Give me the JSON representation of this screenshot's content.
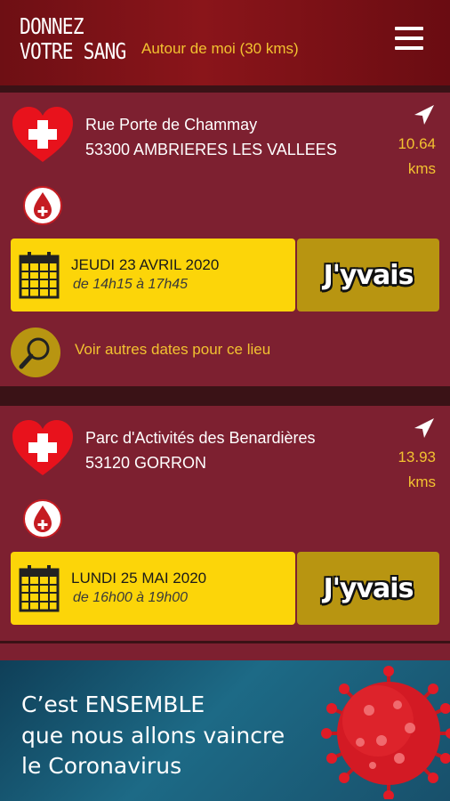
{
  "header": {
    "logo_line1": "DONNEZ",
    "logo_line2": "VOTRE SANG",
    "subtitle": "Autour de moi (30 kms)"
  },
  "collectes": [
    {
      "address_line1": "Rue Porte de Chammay",
      "address_line2": "53300 AMBRIERES LES VALLEES",
      "distance": "10.64",
      "distance_unit": "kms",
      "date": "JEUDI 23 AVRIL 2020",
      "hours": "de 14h15 à 17h45",
      "button_label": "J'yvais",
      "other_dates_label": "Voir autres dates pour ce lieu"
    },
    {
      "address_line1": "Parc d'Activités des Benardières",
      "address_line2": "53120 GORRON",
      "distance": "13.93",
      "distance_unit": "kms",
      "date": "LUNDI 25 MAI 2020",
      "hours": "de 16h00 à 19h00",
      "button_label": "J'yvais"
    }
  ],
  "banner": {
    "line1": "C’est ENSEMBLE",
    "line2": "que nous allons vaincre",
    "line3": "le Coronavirus"
  },
  "colors": {
    "card_bg": "#7d2030",
    "accent_yellow": "#fcd509",
    "button_gold": "#b89511",
    "text_gold": "#f2c230",
    "header_red": "#8a151a",
    "banner_blue": "#1d6a86"
  },
  "icons": [
    "heart-cross-icon",
    "navigation-arrow-icon",
    "blood-drop-icon",
    "calendar-icon",
    "search-icon",
    "menu-icon",
    "virus-icon"
  ]
}
